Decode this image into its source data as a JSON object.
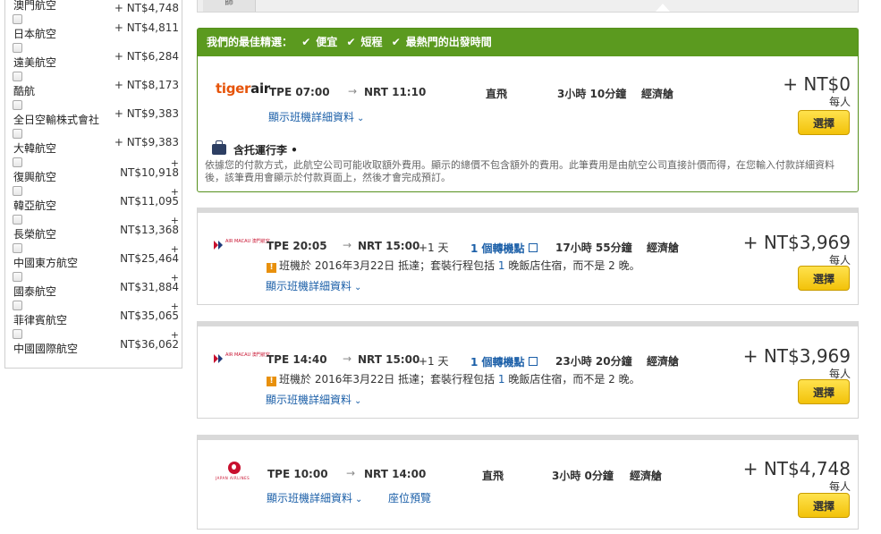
{
  "sidebar": {
    "airlines": [
      {
        "name": "澳門航空",
        "price": "+ NT$4,748"
      },
      {
        "name": "日本航空",
        "price": "+ NT$4,811"
      },
      {
        "name": "遠美航空",
        "price": "+ NT$6,284"
      },
      {
        "name": "酷航",
        "price": "+ NT$8,173"
      },
      {
        "name": "全日空輸株式會社",
        "price": "+ NT$9,383"
      },
      {
        "name": "大韓航空",
        "plus": "+",
        "price": "NT$10,918"
      },
      {
        "name": "復興航空",
        "plus": "+",
        "price": "NT$11,095"
      },
      {
        "name": "韓亞航空",
        "plus": "+",
        "price": "NT$13,368"
      },
      {
        "name": "長榮航空",
        "plus": "+",
        "price": "NT$25,464"
      },
      {
        "name": "中國東方航空",
        "plus": "+",
        "price": "NT$31,884"
      },
      {
        "name": "國泰航空",
        "plus": "+",
        "price": "NT$35,065"
      },
      {
        "name": "菲律賓航空",
        "plus": "+",
        "price": "NT$36,062"
      },
      {
        "name": "中國國際航空"
      }
    ]
  },
  "top_tab": "篩",
  "best": {
    "header": "我們的最佳精選：",
    "tags": [
      "便宜",
      "短程",
      "最熱門的出發時間"
    ],
    "logo": {
      "a": "tiger",
      "b": "air"
    },
    "dep": "TPE 07:00",
    "arr": "NRT 11:10",
    "stops": "直飛",
    "duration": "3小時 10分鐘",
    "cabin": "經濟艙",
    "details_link": "顯示班機詳細資料",
    "price": "+ NT$0",
    "per_person": "每人",
    "select": "選擇",
    "baggage": "含托運行李 •",
    "notice": "依據您的付款方式，此航空公司可能收取額外費用。顯示的總價不包含額外的費用。此筆費用是由航空公司直接計價而得，在您輸入付款詳細資料後，該筆費用會顯示於付款頁面上，然後才會完成預訂。"
  },
  "flights": [
    {
      "logo_text": "AIR MACAU 澳門航空",
      "dep": "TPE 20:05",
      "arr": "NRT 15:00",
      "plusday": "+1 天",
      "stops": "1 個轉機點",
      "duration": "17小時 55分鐘",
      "cabin": "經濟艙",
      "warn_a": "班機於 2016年3月22日 抵達；套裝行程包括 ",
      "warn_n1": "1",
      "warn_b": " 晚飯店住宿，而不是 2 晚。",
      "details_link": "顯示班機詳細資料",
      "price": "+ NT$3,969",
      "per_person": "每人",
      "select": "選擇"
    },
    {
      "logo_text": "AIR MACAU 澳門航空",
      "dep": "TPE 14:40",
      "arr": "NRT 15:00",
      "plusday": "+1 天",
      "stops": "1 個轉機點",
      "duration": "23小時 20分鐘",
      "cabin": "經濟艙",
      "warn_a": "班機於 2016年3月22日 抵達；套裝行程包括 ",
      "warn_n1": "1",
      "warn_b": " 晚飯店住宿，而不是 2 晚。",
      "details_link": "顯示班機詳細資料",
      "price": "+ NT$3,969",
      "per_person": "每人",
      "select": "選擇"
    },
    {
      "logo_text": "JAPAN AIRLINES",
      "dep": "TPE 10:00",
      "arr": "NRT 14:00",
      "stops": "直飛",
      "duration": "3小時 0分鐘",
      "cabin": "經濟艙",
      "details_link": "顯示班機詳細資料",
      "seat_link": "座位預覽",
      "price": "+ NT$4,748",
      "per_person": "每人",
      "select": "選擇"
    }
  ]
}
